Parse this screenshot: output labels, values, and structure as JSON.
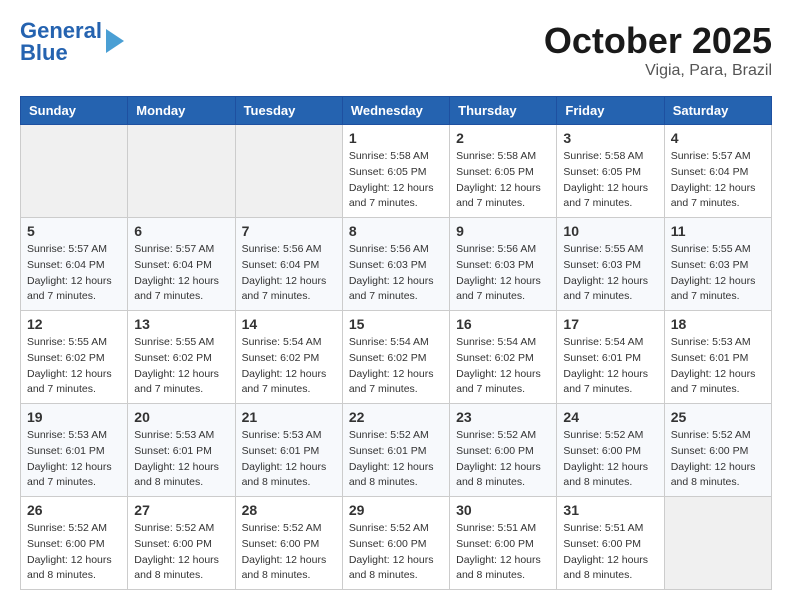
{
  "header": {
    "logo_line1": "General",
    "logo_line2": "Blue",
    "month": "October 2025",
    "location": "Vigia, Para, Brazil"
  },
  "days_of_week": [
    "Sunday",
    "Monday",
    "Tuesday",
    "Wednesday",
    "Thursday",
    "Friday",
    "Saturday"
  ],
  "weeks": [
    [
      {
        "day": "",
        "info": ""
      },
      {
        "day": "",
        "info": ""
      },
      {
        "day": "",
        "info": ""
      },
      {
        "day": "1",
        "info": "Sunrise: 5:58 AM\nSunset: 6:05 PM\nDaylight: 12 hours\nand 7 minutes."
      },
      {
        "day": "2",
        "info": "Sunrise: 5:58 AM\nSunset: 6:05 PM\nDaylight: 12 hours\nand 7 minutes."
      },
      {
        "day": "3",
        "info": "Sunrise: 5:58 AM\nSunset: 6:05 PM\nDaylight: 12 hours\nand 7 minutes."
      },
      {
        "day": "4",
        "info": "Sunrise: 5:57 AM\nSunset: 6:04 PM\nDaylight: 12 hours\nand 7 minutes."
      }
    ],
    [
      {
        "day": "5",
        "info": "Sunrise: 5:57 AM\nSunset: 6:04 PM\nDaylight: 12 hours\nand 7 minutes."
      },
      {
        "day": "6",
        "info": "Sunrise: 5:57 AM\nSunset: 6:04 PM\nDaylight: 12 hours\nand 7 minutes."
      },
      {
        "day": "7",
        "info": "Sunrise: 5:56 AM\nSunset: 6:04 PM\nDaylight: 12 hours\nand 7 minutes."
      },
      {
        "day": "8",
        "info": "Sunrise: 5:56 AM\nSunset: 6:03 PM\nDaylight: 12 hours\nand 7 minutes."
      },
      {
        "day": "9",
        "info": "Sunrise: 5:56 AM\nSunset: 6:03 PM\nDaylight: 12 hours\nand 7 minutes."
      },
      {
        "day": "10",
        "info": "Sunrise: 5:55 AM\nSunset: 6:03 PM\nDaylight: 12 hours\nand 7 minutes."
      },
      {
        "day": "11",
        "info": "Sunrise: 5:55 AM\nSunset: 6:03 PM\nDaylight: 12 hours\nand 7 minutes."
      }
    ],
    [
      {
        "day": "12",
        "info": "Sunrise: 5:55 AM\nSunset: 6:02 PM\nDaylight: 12 hours\nand 7 minutes."
      },
      {
        "day": "13",
        "info": "Sunrise: 5:55 AM\nSunset: 6:02 PM\nDaylight: 12 hours\nand 7 minutes."
      },
      {
        "day": "14",
        "info": "Sunrise: 5:54 AM\nSunset: 6:02 PM\nDaylight: 12 hours\nand 7 minutes."
      },
      {
        "day": "15",
        "info": "Sunrise: 5:54 AM\nSunset: 6:02 PM\nDaylight: 12 hours\nand 7 minutes."
      },
      {
        "day": "16",
        "info": "Sunrise: 5:54 AM\nSunset: 6:02 PM\nDaylight: 12 hours\nand 7 minutes."
      },
      {
        "day": "17",
        "info": "Sunrise: 5:54 AM\nSunset: 6:01 PM\nDaylight: 12 hours\nand 7 minutes."
      },
      {
        "day": "18",
        "info": "Sunrise: 5:53 AM\nSunset: 6:01 PM\nDaylight: 12 hours\nand 7 minutes."
      }
    ],
    [
      {
        "day": "19",
        "info": "Sunrise: 5:53 AM\nSunset: 6:01 PM\nDaylight: 12 hours\nand 7 minutes."
      },
      {
        "day": "20",
        "info": "Sunrise: 5:53 AM\nSunset: 6:01 PM\nDaylight: 12 hours\nand 8 minutes."
      },
      {
        "day": "21",
        "info": "Sunrise: 5:53 AM\nSunset: 6:01 PM\nDaylight: 12 hours\nand 8 minutes."
      },
      {
        "day": "22",
        "info": "Sunrise: 5:52 AM\nSunset: 6:01 PM\nDaylight: 12 hours\nand 8 minutes."
      },
      {
        "day": "23",
        "info": "Sunrise: 5:52 AM\nSunset: 6:00 PM\nDaylight: 12 hours\nand 8 minutes."
      },
      {
        "day": "24",
        "info": "Sunrise: 5:52 AM\nSunset: 6:00 PM\nDaylight: 12 hours\nand 8 minutes."
      },
      {
        "day": "25",
        "info": "Sunrise: 5:52 AM\nSunset: 6:00 PM\nDaylight: 12 hours\nand 8 minutes."
      }
    ],
    [
      {
        "day": "26",
        "info": "Sunrise: 5:52 AM\nSunset: 6:00 PM\nDaylight: 12 hours\nand 8 minutes."
      },
      {
        "day": "27",
        "info": "Sunrise: 5:52 AM\nSunset: 6:00 PM\nDaylight: 12 hours\nand 8 minutes."
      },
      {
        "day": "28",
        "info": "Sunrise: 5:52 AM\nSunset: 6:00 PM\nDaylight: 12 hours\nand 8 minutes."
      },
      {
        "day": "29",
        "info": "Sunrise: 5:52 AM\nSunset: 6:00 PM\nDaylight: 12 hours\nand 8 minutes."
      },
      {
        "day": "30",
        "info": "Sunrise: 5:51 AM\nSunset: 6:00 PM\nDaylight: 12 hours\nand 8 minutes."
      },
      {
        "day": "31",
        "info": "Sunrise: 5:51 AM\nSunset: 6:00 PM\nDaylight: 12 hours\nand 8 minutes."
      },
      {
        "day": "",
        "info": ""
      }
    ]
  ]
}
